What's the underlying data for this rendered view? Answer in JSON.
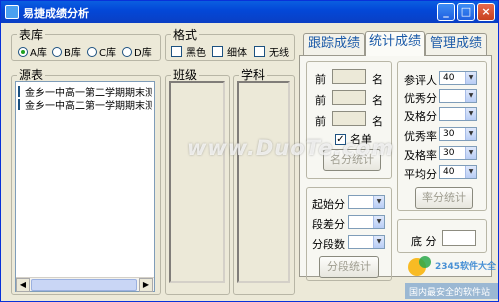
{
  "window": {
    "title": "易捷成绩分析",
    "minimize_glyph": "_",
    "maximize_glyph": "□",
    "close_glyph": "×"
  },
  "library": {
    "legend": "表库",
    "options": [
      {
        "label": "A库",
        "checked": true
      },
      {
        "label": "B库",
        "checked": false
      },
      {
        "label": "C库",
        "checked": false
      },
      {
        "label": "D库",
        "checked": false
      }
    ]
  },
  "format": {
    "legend": "格式",
    "options": [
      {
        "label": "黑色",
        "checked": false
      },
      {
        "label": "细体",
        "checked": false
      },
      {
        "label": "无线",
        "checked": false
      }
    ]
  },
  "source": {
    "legend": "源表",
    "items": [
      {
        "label": "金乡一中高一第二学期期末测试",
        "checked": false
      },
      {
        "label": "金乡一中高二第一学期期末测试",
        "checked": false
      }
    ],
    "scroll_left": "◀",
    "scroll_right": "▶"
  },
  "class_list": {
    "legend": "班级"
  },
  "subject_list": {
    "legend": "学科"
  },
  "tabs": [
    {
      "label": "跟踪成绩",
      "active": false
    },
    {
      "label": "统计成绩",
      "active": true
    },
    {
      "label": "管理成绩",
      "active": false
    }
  ],
  "rank_block": {
    "prefix": "前",
    "suffix": "名",
    "rows": [
      "",
      "",
      ""
    ],
    "list_check_label": "名单",
    "list_checked": true,
    "button": "名分统计"
  },
  "segment_block": {
    "start_label": "起始分",
    "step_label": "段差分",
    "count_label": "分段数",
    "button": "分段统计"
  },
  "rate_block": {
    "rows": [
      {
        "label": "参评人",
        "value": "40"
      },
      {
        "label": "优秀分",
        "value": ""
      },
      {
        "label": "及格分",
        "value": ""
      },
      {
        "label": "优秀率",
        "value": "30"
      },
      {
        "label": "及格率",
        "value": "30"
      },
      {
        "label": "平均分",
        "value": "40"
      }
    ],
    "button": "率分统计"
  },
  "bottom_block": {
    "label": "底  分",
    "value": ""
  },
  "watermark": "www.DuoTe.com",
  "logo_watermark": {
    "brand": "2345软件大全",
    "tagline": "国内最安全的软件站"
  },
  "colors": {
    "titlebar": "#0348d8",
    "window_bg": "#ece9d8",
    "tab_text": "#1b5aa8",
    "radio_dot": "#21a121"
  }
}
